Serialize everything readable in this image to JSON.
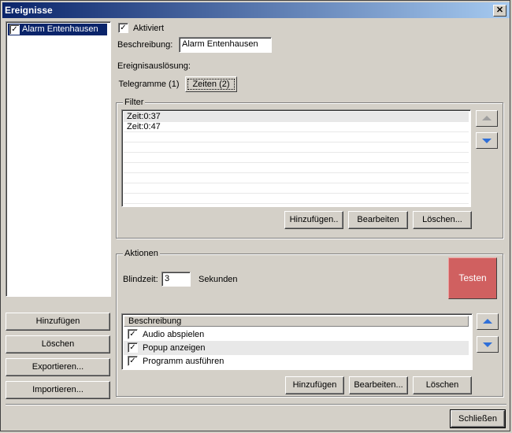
{
  "window": {
    "title": "Ereignisse",
    "close_glyph": "✕"
  },
  "sidebar": {
    "items": [
      {
        "label": "Alarm Entenhausen",
        "checked": true
      }
    ],
    "buttons": {
      "add": "Hinzufügen",
      "delete": "Löschen",
      "export": "Exportieren...",
      "import": "Importieren..."
    }
  },
  "event": {
    "activated_label": "Aktiviert",
    "description_label": "Beschreibung:",
    "description_value": "Alarm Entenhausen",
    "trigger_label": "Ereignisauslösung:"
  },
  "tabs": [
    {
      "label": "Telegramme (1)"
    },
    {
      "label": "Zeiten (2)"
    }
  ],
  "filter": {
    "title": "Filter",
    "rows": [
      "Zeit:0:37",
      "Zeit:0:47"
    ],
    "buttons": {
      "add": "Hinzufügen..",
      "edit": "Bearbeiten",
      "delete": "Löschen..."
    }
  },
  "actions": {
    "title": "Aktionen",
    "blindzeit_label": "Blindzeit:",
    "blindzeit_value": "3",
    "seconds_label": "Sekunden",
    "test_label": "Testen",
    "column_header": "Beschreibung",
    "rows": [
      {
        "label": "Audio abspielen",
        "checked": true
      },
      {
        "label": "Popup anzeigen",
        "checked": true
      },
      {
        "label": "Programm ausführen",
        "checked": true
      }
    ],
    "buttons": {
      "add": "Hinzufügen",
      "edit": "Bearbeiten...",
      "delete": "Löschen"
    }
  },
  "footer": {
    "close_label": "Schließen"
  },
  "colors": {
    "test_button": "#d06060",
    "title_from": "#0a246a",
    "title_to": "#a6caf0",
    "selection": "#0a246a"
  }
}
